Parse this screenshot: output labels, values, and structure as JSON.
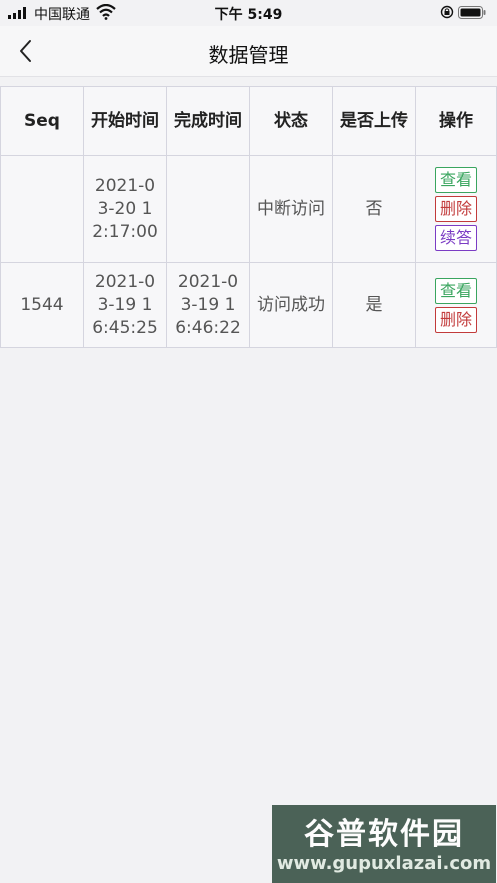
{
  "status_bar": {
    "carrier": "中国联通",
    "time": "下午 5:49"
  },
  "nav": {
    "title": "数据管理"
  },
  "table": {
    "headers": [
      "Seq",
      "开始时间",
      "完成时间",
      "状态",
      "是否上传",
      "操作"
    ],
    "rows": [
      {
        "seq": "",
        "start": "2021-03-20 12:17:00",
        "end": "",
        "status": "中断访问",
        "uploaded": "否",
        "actions": [
          "查看",
          "删除",
          "续答"
        ]
      },
      {
        "seq": "1544",
        "start": "2021-03-19 16:45:25",
        "end": "2021-03-19 16:46:22",
        "status": "访问成功",
        "uploaded": "是",
        "actions": [
          "查看",
          "删除"
        ]
      }
    ]
  },
  "watermark": {
    "title": "谷普软件园",
    "url": "www.gupuxlazai.com"
  },
  "colors": {
    "view": "#3aa55f",
    "delete": "#c23b3b",
    "continue": "#7b3cc4"
  }
}
